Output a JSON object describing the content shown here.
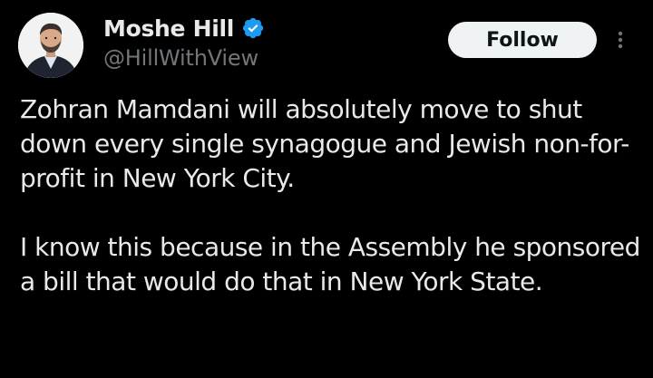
{
  "author": {
    "display_name": "Moshe Hill",
    "handle": "@HillWithView",
    "verified": true
  },
  "actions": {
    "follow_label": "Follow",
    "more_icon": "more-vertical-icon"
  },
  "tweet": {
    "paragraphs": [
      "Zohran Mamdani will absolutely move to shut down every single synagogue and Jewish non-for-profit in New York City.",
      "I know this because in the Assembly he sponsored a bill that would do that in New York State."
    ]
  },
  "colors": {
    "background": "#000000",
    "text_primary": "#e7e9ea",
    "text_secondary": "#71767b",
    "verified_blue": "#1d9bf0",
    "follow_bg": "#eff3f4"
  }
}
